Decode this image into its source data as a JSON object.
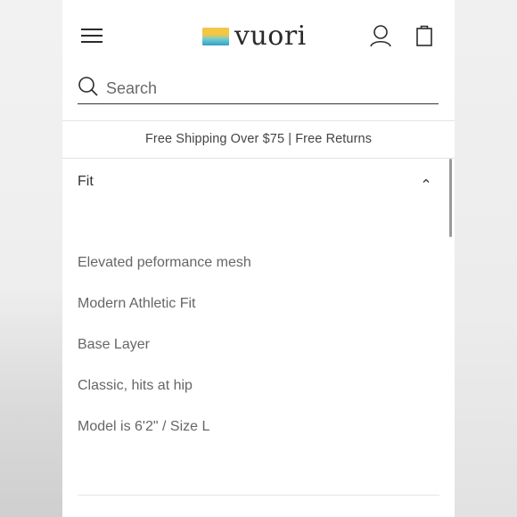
{
  "brand": {
    "name": "vuori"
  },
  "search": {
    "placeholder": "Search",
    "value": ""
  },
  "banner": {
    "text": "Free Shipping Over $75 | Free Returns"
  },
  "accordion": {
    "title": "Fit",
    "expanded": true,
    "items": [
      "Elevated peformance mesh",
      "Modern Athletic Fit",
      "Base Layer",
      "Classic, hits at hip",
      "Model is 6'2\" / Size L"
    ]
  },
  "icons": {
    "menu": "hamburger-menu-icon",
    "account": "user-icon",
    "cart": "shopping-bag-icon",
    "search": "search-icon",
    "toggle": "chevron-up-icon"
  },
  "colors": {
    "text_dark": "#2b2b2b",
    "text_muted": "#666666",
    "logo_yellow": "#f3c644",
    "logo_blue": "#2f9fd6"
  }
}
